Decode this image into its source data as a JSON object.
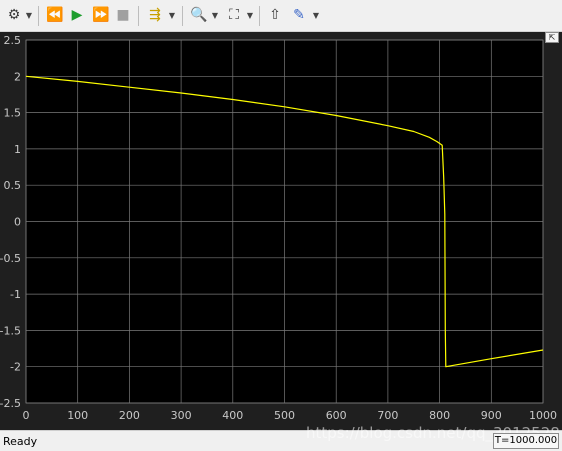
{
  "toolbar": {
    "buttons": [
      {
        "name": "settings-icon",
        "glyph": "⚙"
      },
      {
        "name": "step-back-icon",
        "glyph": "⏪"
      },
      {
        "name": "run-icon",
        "glyph": "▶"
      },
      {
        "name": "step-forward-icon",
        "glyph": "⏩"
      },
      {
        "name": "stop-icon",
        "glyph": "■"
      },
      {
        "name": "highlight-signal-icon",
        "glyph": "⇶"
      },
      {
        "name": "zoom-icon",
        "glyph": "🔍"
      },
      {
        "name": "fit-to-view-icon",
        "glyph": "⛶"
      },
      {
        "name": "triggers-icon",
        "glyph": "⇧"
      },
      {
        "name": "style-icon",
        "glyph": "✎"
      }
    ]
  },
  "chart_data": {
    "type": "line",
    "xlim": [
      0,
      1000
    ],
    "ylim": [
      -2.5,
      2.5
    ],
    "xticks": [
      "0",
      "100",
      "200",
      "300",
      "400",
      "500",
      "600",
      "700",
      "800",
      "900",
      "1000"
    ],
    "yticks": [
      "2.5",
      "2",
      "1.5",
      "1",
      "0.5",
      "0",
      "-0.5",
      "-1",
      "-1.5",
      "-2",
      "-2.5"
    ],
    "grid": true,
    "series": [
      {
        "color": "#ffff00",
        "x": [
          0,
          100,
          200,
          300,
          400,
          500,
          600,
          700,
          750,
          780,
          795,
          805,
          808,
          810,
          811,
          812,
          900,
          1000
        ],
        "y": [
          2.0,
          1.93,
          1.85,
          1.77,
          1.68,
          1.58,
          1.46,
          1.32,
          1.24,
          1.16,
          1.1,
          1.05,
          0.6,
          0.1,
          -1.5,
          -2.0,
          -1.89,
          -1.77
        ]
      }
    ]
  },
  "colors": {
    "background": "#000000",
    "grid": "#7a7a7a",
    "tick_text": "#c8c8c8"
  },
  "status": {
    "text": "Ready",
    "watermark": "https://blog.csdn.net/qq_3012528",
    "time": "T=1000.000"
  }
}
